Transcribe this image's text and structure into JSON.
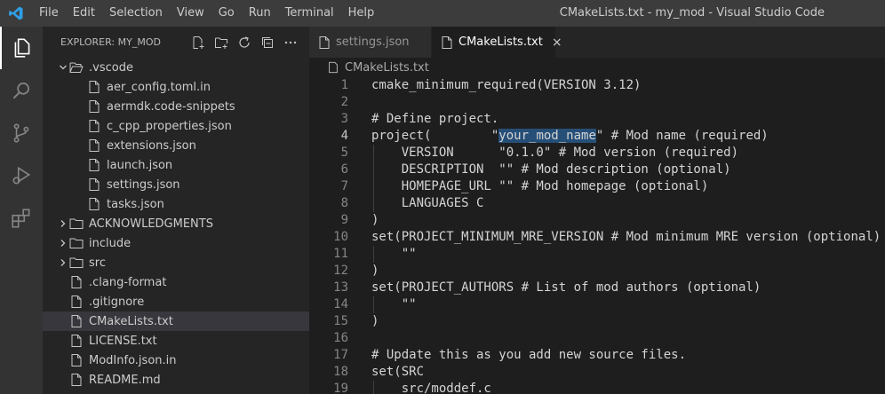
{
  "window": {
    "title": "CMakeLists.txt - my_mod - Visual Studio Code"
  },
  "menu": [
    "File",
    "Edit",
    "Selection",
    "View",
    "Go",
    "Run",
    "Terminal",
    "Help"
  ],
  "activity_bar": [
    {
      "name": "explorer-icon",
      "active": true
    },
    {
      "name": "search-icon",
      "active": false
    },
    {
      "name": "source-control-icon",
      "active": false
    },
    {
      "name": "run-debug-icon",
      "active": false
    },
    {
      "name": "extensions-icon",
      "active": false
    }
  ],
  "explorer": {
    "header": "EXPLORER: MY_MOD",
    "actions": [
      "new-file-icon",
      "new-folder-icon",
      "refresh-icon",
      "collapse-all-icon",
      "more-icon"
    ],
    "items": [
      {
        "label": ".vscode",
        "kind": "folder",
        "depth": 0,
        "expanded": true
      },
      {
        "label": "aer_config.toml.in",
        "kind": "file",
        "depth": 1
      },
      {
        "label": "aermdk.code-snippets",
        "kind": "file",
        "depth": 1
      },
      {
        "label": "c_cpp_properties.json",
        "kind": "file",
        "depth": 1
      },
      {
        "label": "extensions.json",
        "kind": "file",
        "depth": 1
      },
      {
        "label": "launch.json",
        "kind": "file",
        "depth": 1
      },
      {
        "label": "settings.json",
        "kind": "file",
        "depth": 1
      },
      {
        "label": "tasks.json",
        "kind": "file",
        "depth": 1
      },
      {
        "label": "ACKNOWLEDGMENTS",
        "kind": "folder",
        "depth": 0,
        "expanded": false
      },
      {
        "label": "include",
        "kind": "folder",
        "depth": 0,
        "expanded": false
      },
      {
        "label": "src",
        "kind": "folder",
        "depth": 0,
        "expanded": false
      },
      {
        "label": ".clang-format",
        "kind": "file",
        "depth": 0
      },
      {
        "label": ".gitignore",
        "kind": "file",
        "depth": 0
      },
      {
        "label": "CMakeLists.txt",
        "kind": "file",
        "depth": 0,
        "selected": true
      },
      {
        "label": "LICENSE.txt",
        "kind": "file",
        "depth": 0
      },
      {
        "label": "ModInfo.json.in",
        "kind": "file",
        "depth": 0
      },
      {
        "label": "README.md",
        "kind": "file",
        "depth": 0
      }
    ]
  },
  "tabs": [
    {
      "label": "settings.json",
      "active": false
    },
    {
      "label": "CMakeLists.txt",
      "active": true,
      "close": "×"
    }
  ],
  "breadcrumb": "CMakeLists.txt",
  "editor": {
    "current_line": 4,
    "lines": [
      {
        "n": "1",
        "text": "cmake_minimum_required(VERSION 3.12)"
      },
      {
        "n": "2",
        "text": ""
      },
      {
        "n": "3",
        "text": "# Define project."
      },
      {
        "n": "4",
        "before": "project(        \"",
        "sel": "your_mod_name",
        "after": "\" # Mod name (required)"
      },
      {
        "n": "5",
        "text": "    VERSION      \"0.1.0\" # Mod version (required)"
      },
      {
        "n": "6",
        "text": "    DESCRIPTION  \"\" # Mod description (optional)"
      },
      {
        "n": "7",
        "text": "    HOMEPAGE_URL \"\" # Mod homepage (optional)"
      },
      {
        "n": "8",
        "text": "    LANGUAGES C"
      },
      {
        "n": "9",
        "text": ")"
      },
      {
        "n": "10",
        "text": "set(PROJECT_MINIMUM_MRE_VERSION # Mod minimum MRE version (optional)"
      },
      {
        "n": "11",
        "text": "    \"\""
      },
      {
        "n": "12",
        "text": ")"
      },
      {
        "n": "13",
        "text": "set(PROJECT_AUTHORS # List of mod authors (optional)"
      },
      {
        "n": "14",
        "text": "    \"\""
      },
      {
        "n": "15",
        "text": ")"
      },
      {
        "n": "16",
        "text": ""
      },
      {
        "n": "17",
        "text": "# Update this as you add new source files."
      },
      {
        "n": "18",
        "text": "set(SRC"
      },
      {
        "n": "19",
        "text": "    src/moddef.c"
      }
    ]
  },
  "colors": {
    "accent": "#007acc",
    "selection": "#264f78",
    "sidebar": "#252526",
    "editor_bg": "#1e1e1e"
  }
}
